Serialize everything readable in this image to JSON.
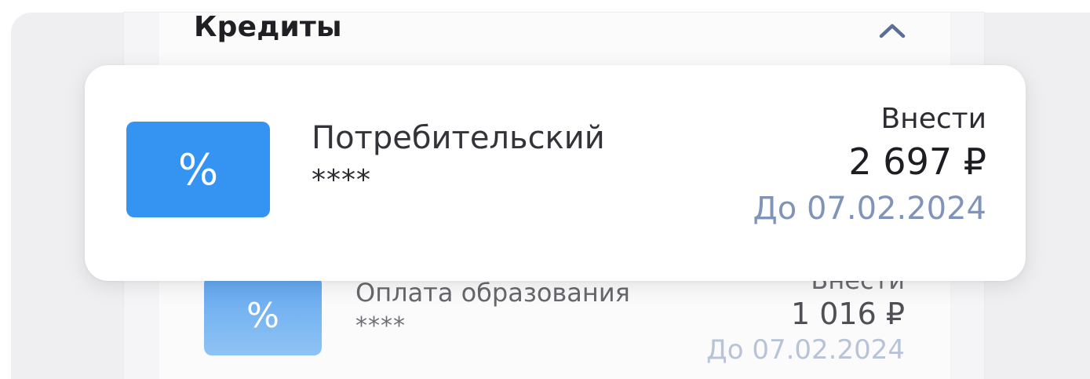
{
  "section": {
    "title": "Кредиты",
    "collapse_icon": "chevron-up-icon"
  },
  "loans": [
    {
      "icon": "%",
      "name": "Потребительский",
      "masked_number": "****",
      "pay_label": "Внести",
      "amount": "2 697 ₽",
      "due": "До 07.02.2024",
      "icon_color": "#3593f2"
    },
    {
      "icon": "%",
      "name": "Оплата образования",
      "masked_number": "****",
      "pay_label": "Внести",
      "amount": "1 016 ₽",
      "due": "До 07.02.2024",
      "icon_color": "#62a7ef"
    }
  ],
  "colors": {
    "accent": "#3593f2",
    "due_date": "#7f94b8"
  }
}
